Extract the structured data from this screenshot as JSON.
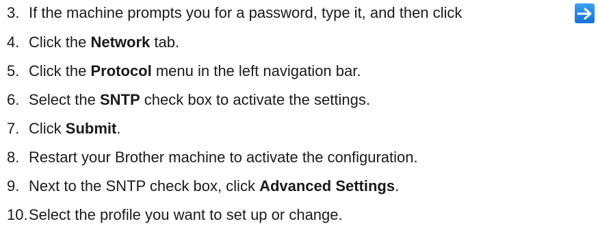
{
  "steps": [
    {
      "num": "3.",
      "parts": [
        {
          "t": "If the machine prompts you for a password, type it, and then click "
        }
      ]
    },
    {
      "num": "4.",
      "parts": [
        {
          "t": "Click the "
        },
        {
          "t": "Network",
          "b": true
        },
        {
          "t": " tab."
        }
      ]
    },
    {
      "num": "5.",
      "parts": [
        {
          "t": "Click the "
        },
        {
          "t": "Protocol",
          "b": true
        },
        {
          "t": " menu in the left navigation bar."
        }
      ]
    },
    {
      "num": "6.",
      "parts": [
        {
          "t": "Select the "
        },
        {
          "t": "SNTP",
          "b": true
        },
        {
          "t": " check box to activate the settings."
        }
      ]
    },
    {
      "num": "7.",
      "parts": [
        {
          "t": "Click "
        },
        {
          "t": "Submit",
          "b": true
        },
        {
          "t": "."
        }
      ]
    },
    {
      "num": "8.",
      "parts": [
        {
          "t": "Restart your Brother machine to activate the configuration."
        }
      ]
    },
    {
      "num": "9.",
      "parts": [
        {
          "t": "Next to the SNTP check box, click "
        },
        {
          "t": "Advanced Settings",
          "b": true
        },
        {
          "t": "."
        }
      ]
    },
    {
      "num": "10.",
      "parts": [
        {
          "t": "Select the profile you want to set up or change."
        }
      ]
    }
  ],
  "icons": {
    "submit_arrow": "arrow-right-icon",
    "submit_arrow_color": "#1572d4"
  }
}
